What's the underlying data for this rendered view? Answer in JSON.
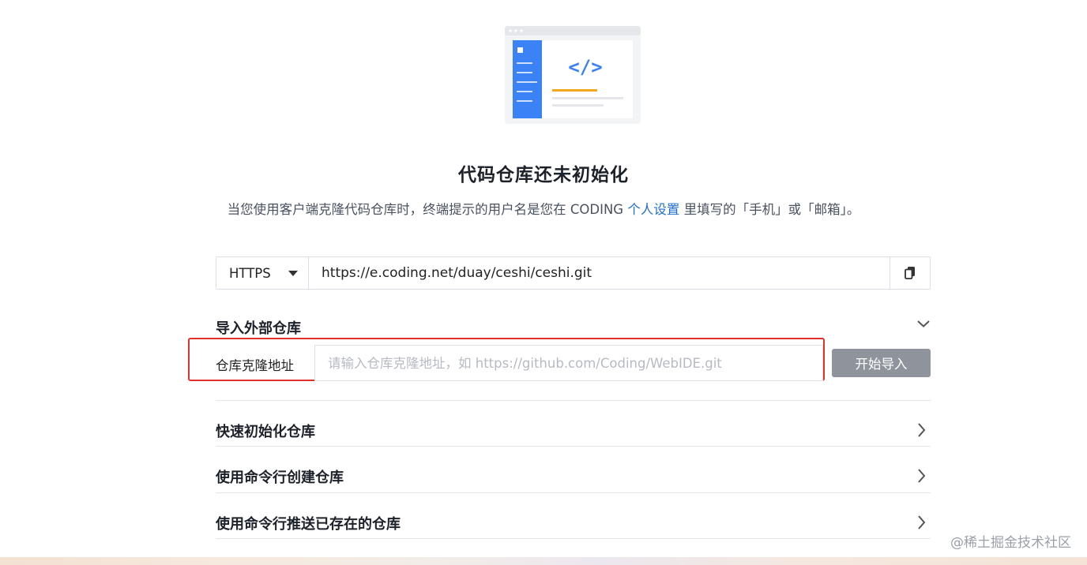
{
  "empty_state": {
    "title": "代码仓库还未初始化",
    "subtitle_prefix": "当您使用客户端克隆代码仓库时，终端提示的用户名是您在 CODING ",
    "subtitle_link": "个人设置",
    "subtitle_suffix": " 里填写的「手机」或「邮箱」。"
  },
  "clone": {
    "protocol": "HTTPS",
    "url": "https://e.coding.net/duay/ceshi/ceshi.git",
    "copy_icon": "copy-icon"
  },
  "import": {
    "section_label": "导入外部仓库",
    "field_label": "仓库克隆地址",
    "placeholder": "请输入仓库克隆地址，如 https://github.com/Coding/WebIDE.git",
    "button_label": "开始导入",
    "highlight_color": "#e0312b"
  },
  "sections": [
    {
      "label": "快速初始化仓库"
    },
    {
      "label": "使用命令行创建仓库"
    },
    {
      "label": "使用命令行推送已存在的仓库"
    }
  ],
  "watermark": "@稀土掘金技术社区",
  "colors": {
    "accent": "#1f6fd0",
    "illustration_blue": "#3b82f6",
    "illustration_orange": "#f5a623",
    "button_disabled": "#8f949c"
  }
}
